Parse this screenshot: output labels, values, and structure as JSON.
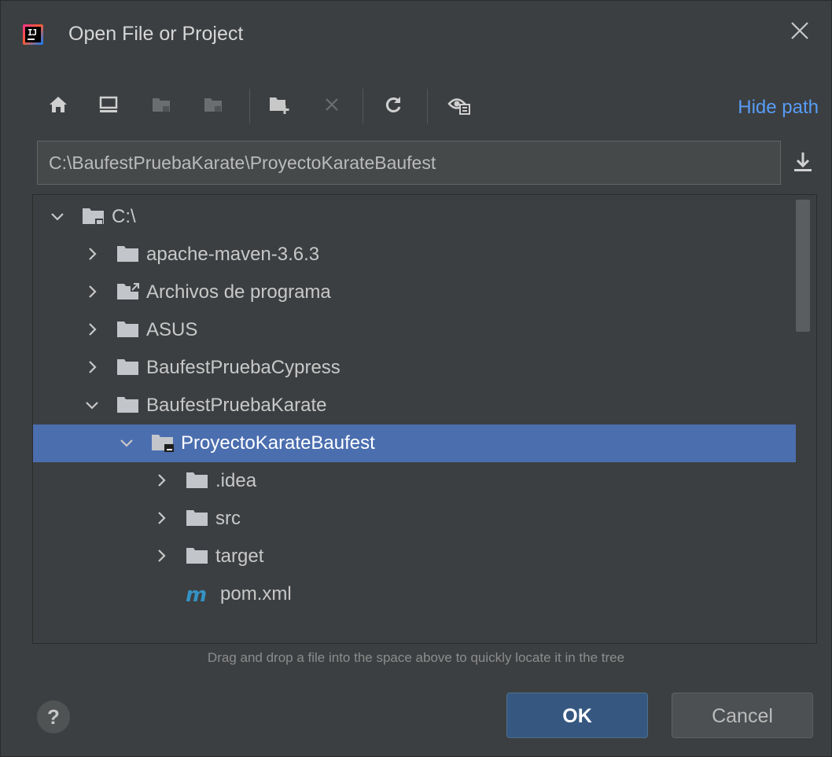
{
  "window": {
    "title": "Open File or Project"
  },
  "toolbar": {
    "icons": [
      "home-icon",
      "desktop-icon",
      "project-folder-icon",
      "module-folder-icon",
      "new-folder-icon",
      "delete-icon",
      "refresh-icon",
      "show-hidden-icon"
    ],
    "hide_path_label": "Hide path"
  },
  "path": {
    "value": "C:\\BaufestPruebaKarate\\ProyectoKarateBaufest"
  },
  "tree": {
    "items": [
      {
        "label": "C:\\",
        "expanded": true,
        "depth": 0,
        "icon": "drive-folder-icon"
      },
      {
        "label": "apache-maven-3.6.3",
        "expanded": false,
        "depth": 1,
        "icon": "folder-icon"
      },
      {
        "label": "Archivos de programa",
        "expanded": false,
        "depth": 1,
        "icon": "folder-link-icon"
      },
      {
        "label": "ASUS",
        "expanded": false,
        "depth": 1,
        "icon": "folder-icon"
      },
      {
        "label": "BaufestPruebaCypress",
        "expanded": false,
        "depth": 1,
        "icon": "folder-icon"
      },
      {
        "label": "BaufestPruebaKarate",
        "expanded": true,
        "depth": 1,
        "icon": "folder-icon"
      },
      {
        "label": "ProyectoKarateBaufest",
        "expanded": true,
        "depth": 2,
        "icon": "project-folder-icon",
        "selected": true
      },
      {
        "label": ".idea",
        "expanded": false,
        "depth": 3,
        "icon": "folder-icon"
      },
      {
        "label": "src",
        "expanded": false,
        "depth": 3,
        "icon": "folder-icon"
      },
      {
        "label": "target",
        "expanded": false,
        "depth": 3,
        "icon": "folder-icon"
      },
      {
        "label": "pom.xml",
        "depth": 3,
        "icon": "maven-file-icon"
      }
    ]
  },
  "hint": "Drag and drop a file into the space above to quickly locate it in the tree",
  "buttons": {
    "help": "?",
    "ok": "OK",
    "cancel": "Cancel"
  },
  "colors": {
    "background": "#3c3f41",
    "selection": "#4b6eaf",
    "link": "#589df6",
    "ok_button": "#365880"
  }
}
